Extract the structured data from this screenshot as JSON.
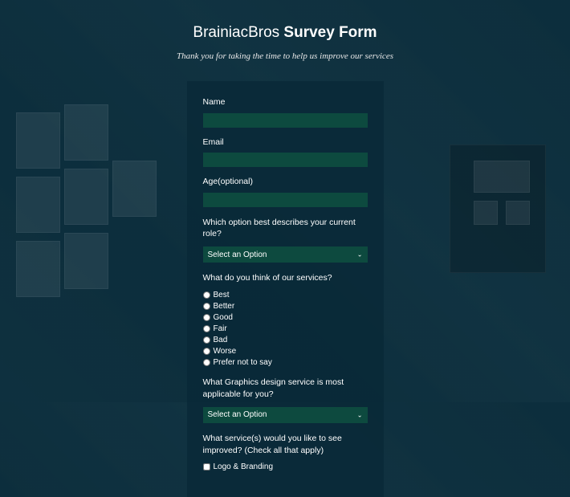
{
  "header": {
    "title_part1": "BrainiacBros ",
    "title_part2": "Survey Form",
    "subtitle": "Thank you for taking the time to help us improve our services"
  },
  "form": {
    "name_label": "Name",
    "email_label": "Email",
    "age_label": "Age(optional)",
    "role_question": "Which option best describes your current role?",
    "role_select": "Select an Option",
    "service_question": "What do you think of our services?",
    "service_options": {
      "o0": "Best",
      "o1": "Better",
      "o2": "Good",
      "o3": "Fair",
      "o4": "Bad",
      "o5": "Worse",
      "o6": "Prefer not to say"
    },
    "graphics_question": "What Graphics design service is most applicable for you?",
    "graphics_select": "Select an Option",
    "improve_question": "What service(s) would you like to see improved? (Check all that apply)",
    "improve_options": {
      "c0": "Logo & Branding"
    }
  }
}
